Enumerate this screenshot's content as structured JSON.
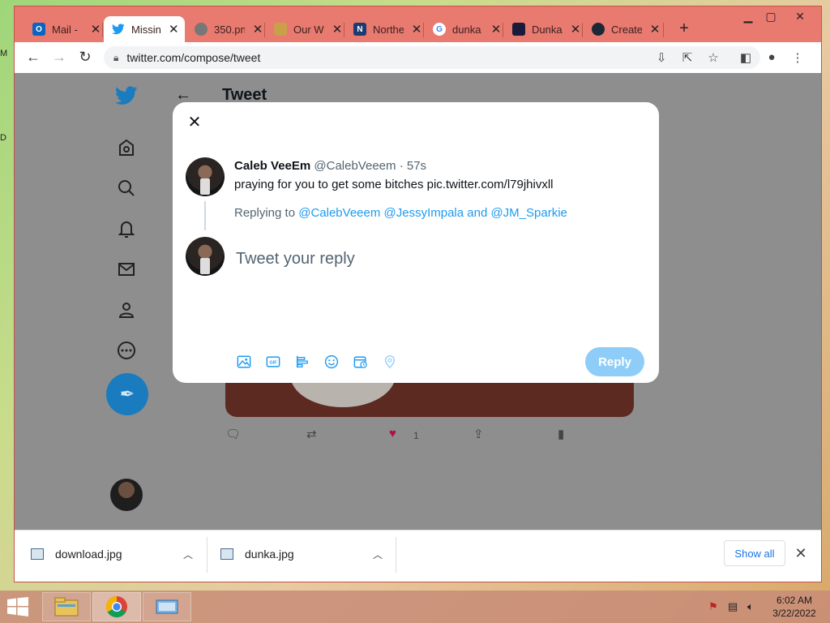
{
  "browser": {
    "tabs": [
      {
        "label": "Mail -",
        "icon": "outlook-icon",
        "color": "#0a64c2"
      },
      {
        "label": "Missing",
        "icon": "twitter-icon",
        "color": "#1d9bf0",
        "active": true
      },
      {
        "label": "350.pn",
        "icon": "globe-icon",
        "color": "#777777"
      },
      {
        "label": "Our W",
        "icon": "site-icon",
        "color": "#c9a04a"
      },
      {
        "label": "Northe",
        "icon": "n-icon",
        "color": "#1d3b73"
      },
      {
        "label": "dunka",
        "icon": "google-icon",
        "color": "#4285f4"
      },
      {
        "label": "Dunka",
        "icon": "knowyourmeme-icon",
        "color": "#1a1a3a"
      },
      {
        "label": "Create",
        "icon": "steam-icon",
        "color": "#1b2838"
      }
    ],
    "new_tab": "+",
    "url": "twitter.com/compose/tweet"
  },
  "background_page": {
    "title": "Tweet",
    "like_count": "1"
  },
  "modal": {
    "author_name": "Caleb VeeEm",
    "author_handle": "@CalebVeeem",
    "time": "· 57s",
    "tweet_text": "praying for you to get some bitches pic.twitter.com/l79jhivxll",
    "replying_prefix": "Replying to ",
    "replying_to": "@CalebVeeem @JessyImpala and @JM_Sparkie",
    "reply_placeholder": "Tweet your reply",
    "reply_button": "Reply"
  },
  "downloads": {
    "items": [
      {
        "name": "download.jpg"
      },
      {
        "name": "dunka.jpg"
      }
    ],
    "show_all": "Show all"
  },
  "taskbar": {
    "time": "6:02 AM",
    "date": "3/22/2022"
  },
  "colors": {
    "twitter_blue": "#1d9bf0",
    "chrome_frame": "#e97a6f",
    "reply_disabled": "#8ecdf8"
  }
}
